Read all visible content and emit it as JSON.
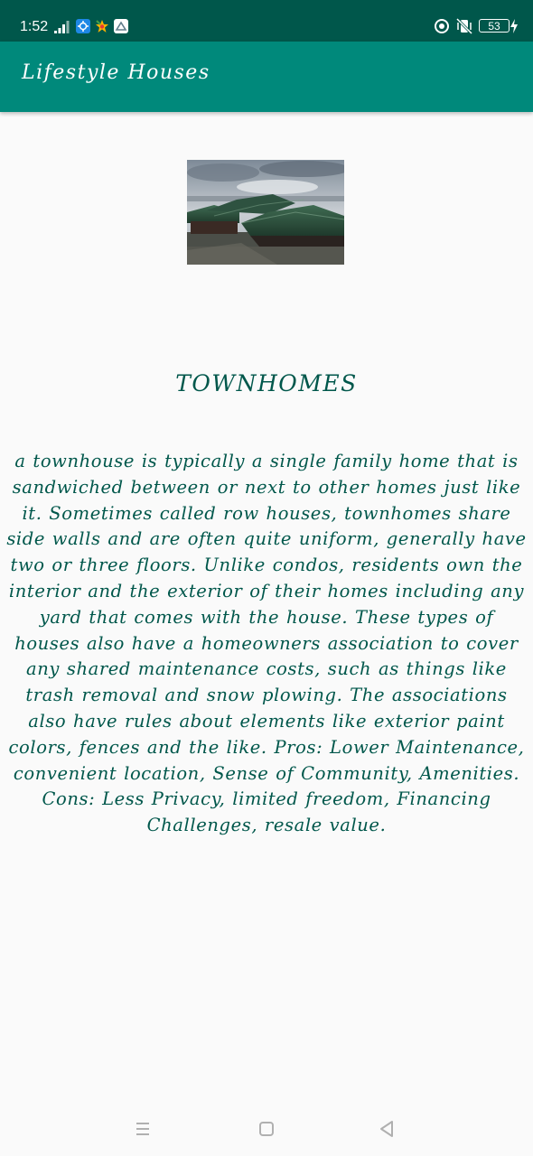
{
  "status_bar": {
    "time": "1:52",
    "battery": "53",
    "icons": [
      "signal-icon",
      "vpn-icon",
      "app-icon",
      "gallery-icon",
      "data-saver-icon",
      "vibrate-icon",
      "battery-icon",
      "charging-icon"
    ]
  },
  "app_bar": {
    "title": "Lifestyle Houses"
  },
  "content": {
    "image": "townhome-photo",
    "heading": "TOWNHOMES",
    "description": "a townhouse is typically a single family home that is sandwiched between or next to other homes just like it. Sometimes called row houses, townhomes share side walls and are often quite uniform, generally have two or three floors. Unlike condos, residents own the interior and the exterior of their homes including any yard that comes with the house. These types of houses also have a homeowners association to cover any shared maintenance costs, such as things like trash removal and snow plowing. The associations also have rules about elements like exterior paint colors, fences and the like.  Pros: Lower Maintenance, convenient location, Sense of Community, Amenities.  Cons: Less Privacy, limited freedom, Financing Challenges, resale value."
  },
  "nav_bar": {
    "buttons": [
      "recents-icon",
      "home-icon",
      "back-icon"
    ]
  },
  "colors": {
    "status_bar": "#00574b",
    "app_bar": "#00897b",
    "text": "#00574b",
    "background": "#fafafa"
  }
}
